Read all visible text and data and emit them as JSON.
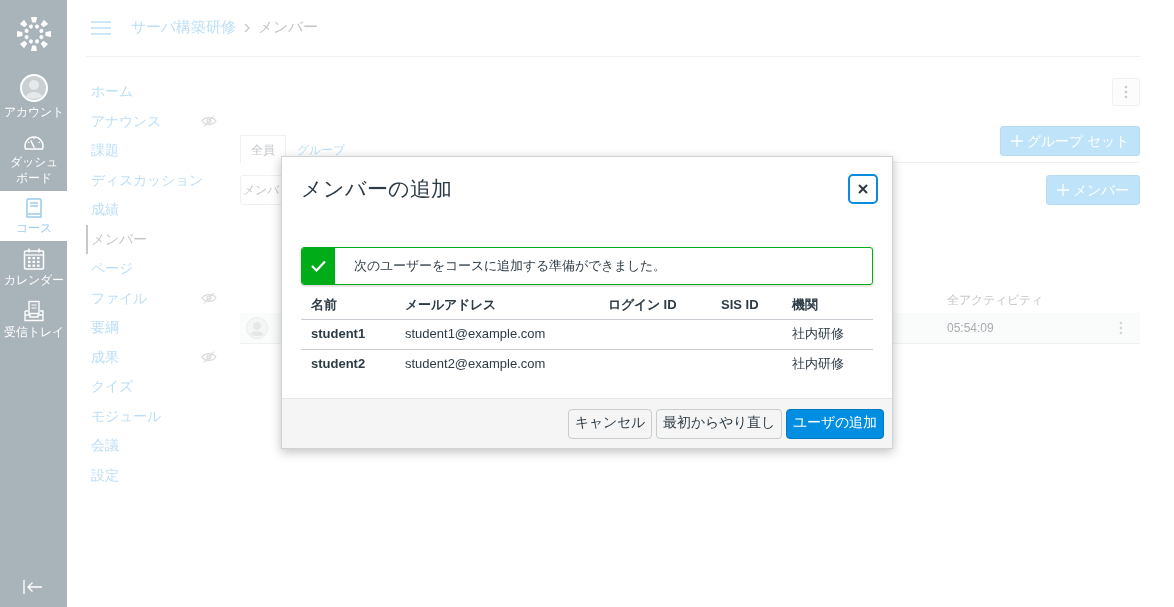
{
  "global_nav": {
    "items": [
      {
        "kind": "account",
        "label_lines": [
          "アカウント"
        ],
        "selected": false
      },
      {
        "kind": "dashboard",
        "label_lines": [
          "ダッシュ",
          "ボード"
        ],
        "selected": false
      },
      {
        "kind": "courses",
        "label_lines": [
          "コース"
        ],
        "selected": true
      },
      {
        "kind": "calendar",
        "label_lines": [
          "カレンダー"
        ],
        "selected": false
      },
      {
        "kind": "inbox",
        "label_lines": [
          "受信トレイ"
        ],
        "selected": false
      }
    ]
  },
  "breadcrumb": [
    {
      "label": "サーバ構築研修",
      "current": false
    },
    {
      "label": "メンバー",
      "current": true
    }
  ],
  "course_nav": {
    "items": [
      {
        "label": "ホーム",
        "selected": false,
        "hidden": false
      },
      {
        "label": "アナウンス",
        "selected": false,
        "hidden": true
      },
      {
        "label": "課題",
        "selected": false,
        "hidden": false
      },
      {
        "label": "ディスカッション",
        "selected": false,
        "hidden": false
      },
      {
        "label": "成績",
        "selected": false,
        "hidden": false
      },
      {
        "label": "メンバー",
        "selected": true,
        "hidden": false
      },
      {
        "label": "ページ",
        "selected": false,
        "hidden": false
      },
      {
        "label": "ファイル",
        "selected": false,
        "hidden": true
      },
      {
        "label": "要綱",
        "selected": false,
        "hidden": false
      },
      {
        "label": "成果",
        "selected": false,
        "hidden": true
      },
      {
        "label": "クイズ",
        "selected": false,
        "hidden": false
      },
      {
        "label": "モジュール",
        "selected": false,
        "hidden": false
      },
      {
        "label": "会議",
        "selected": false,
        "hidden": false
      },
      {
        "label": "設定",
        "selected": false,
        "hidden": false
      }
    ]
  },
  "page": {
    "tabs": [
      {
        "label": "全員",
        "selected": true
      },
      {
        "label": "グループ",
        "selected": false
      }
    ],
    "group_set_button": {
      "label": "グループ セット"
    },
    "search": {
      "placeholder": "メンバ"
    },
    "add_member_button": {
      "label": "メンバー"
    },
    "table": {
      "column_header": "全アクティビティ",
      "rows": [
        {
          "last_activity": "05:54:09"
        }
      ]
    }
  },
  "dialog": {
    "title": "メンバーの追加",
    "alert": {
      "kind": "success",
      "message": "次のユーザーをコースに追加する準備ができました。"
    },
    "table": {
      "columns": [
        "名前",
        "メールアドレス",
        "ログイン ID",
        "SIS ID",
        "機関"
      ],
      "rows": [
        {
          "name": "student1",
          "email": "student1@example.com",
          "institution": "社内研修"
        },
        {
          "name": "student2",
          "email": "student2@example.com",
          "institution": "社内研修"
        }
      ]
    },
    "buttons": [
      {
        "label": "キャンセル",
        "kind": "secondary"
      },
      {
        "label": "最初からやり直し",
        "kind": "secondary"
      },
      {
        "label": "ユーザの追加",
        "kind": "primary"
      }
    ]
  }
}
